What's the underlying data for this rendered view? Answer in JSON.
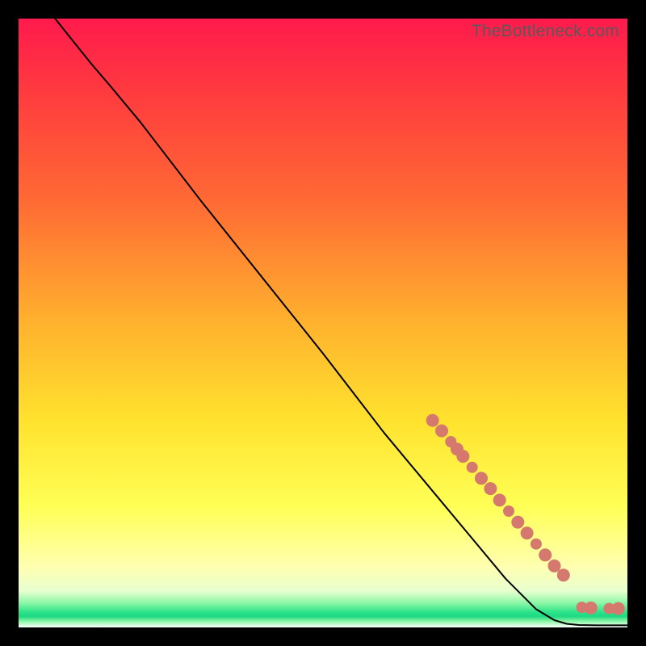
{
  "watermark": "TheBottleneck.com",
  "colors": {
    "frame": "#000000",
    "watermark": "#595959",
    "line": "#000000",
    "dot": "#d5786d"
  },
  "chart_data": {
    "type": "line",
    "title": "",
    "xlabel": "",
    "ylabel": "",
    "xlim": [
      0,
      100
    ],
    "ylim": [
      0,
      100
    ],
    "note": "Axes are unlabeled in the source image; x/y expressed as 0–100 percent of plot area. y=100 is top, y=0 is bottom.",
    "series": [
      {
        "name": "bottleneck-curve",
        "x": [
          6,
          8,
          10,
          12,
          15,
          20,
          30,
          40,
          50,
          60,
          70,
          75,
          80,
          85,
          88,
          90,
          92,
          95,
          100
        ],
        "y": [
          100,
          97.5,
          95,
          92.5,
          89,
          83,
          70,
          57.5,
          45,
          32,
          20,
          14,
          8,
          3,
          1.2,
          0.6,
          0.4,
          0.35,
          0.35
        ]
      }
    ],
    "markers": {
      "name": "highlighted-points",
      "x": [
        68,
        69.5,
        71,
        72,
        73,
        74.5,
        76,
        77.5,
        79,
        80.5,
        82,
        83.5,
        85,
        86.5,
        88,
        89.5,
        92.5,
        94,
        97,
        98.5
      ],
      "y": [
        34,
        32.3,
        30.5,
        29.3,
        28.1,
        26.3,
        24.5,
        22.8,
        20.9,
        19.1,
        17.3,
        15.5,
        13.7,
        11.9,
        10.1,
        8.6,
        3.3,
        3.2,
        3.1,
        3.1
      ],
      "r": [
        8,
        8,
        7,
        8,
        8,
        7,
        8,
        8,
        8,
        7,
        8,
        8,
        7,
        8,
        8,
        8,
        7,
        8,
        7,
        8
      ]
    }
  }
}
